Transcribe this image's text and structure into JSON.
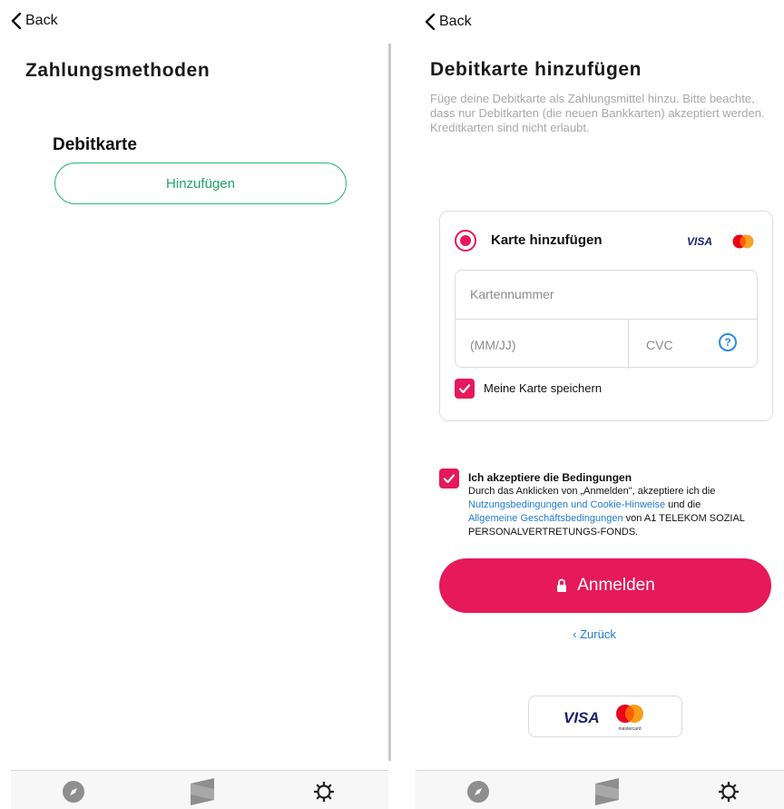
{
  "left_screen": {
    "back_label": "Back",
    "title": "Zahlungsmethoden",
    "card_title": "Debitkarte",
    "add_button_label": "Hinzufügen"
  },
  "right_screen": {
    "back_label": "Back",
    "title": "Debitkarte hinzufügen",
    "description": "Füge deine Debitkarte als Zahlungsmittel hinzu. Bitte beachte, dass nur Debitkarten (die neuen Bankkarten) akzeptiert werden. Kreditkarten sind nicht erlaubt.",
    "payment_option_label": "Karte hinzufügen",
    "visa_text": "VISA",
    "card_number_placeholder": "Kartennummer",
    "expiry_placeholder": "(MM/JJ)",
    "cvc_placeholder": "CVC",
    "help_glyph": "?",
    "save_card_label": "Meine Karte speichern",
    "terms_title": "Ich akzeptiere die Bedingungen",
    "terms_text_1": "Durch das Anklicken von „Anmelden\", akzeptiere ich die",
    "terms_link_1": "Nutzungsbedingungen und Cookie-Hinweise",
    "terms_text_2": " und die",
    "terms_link_2": "Allgemeine Geschäftsbedingungen",
    "terms_text_3": " von A1 TELEKOM SOZIAL PERSONALVERTRETUNGS-FONDS.",
    "submit_label": "Anmelden",
    "back_link": "‹ Zurück",
    "brand_visa": "VISA",
    "brand_mastercard": "mastercard"
  },
  "colors": {
    "accent_pink": "#e6195a",
    "accent_green": "#1fa862",
    "link_blue": "#1f7ccf"
  },
  "tabbar_icons": [
    "compass-icon",
    "logo-icon",
    "settings-gear-icon"
  ]
}
